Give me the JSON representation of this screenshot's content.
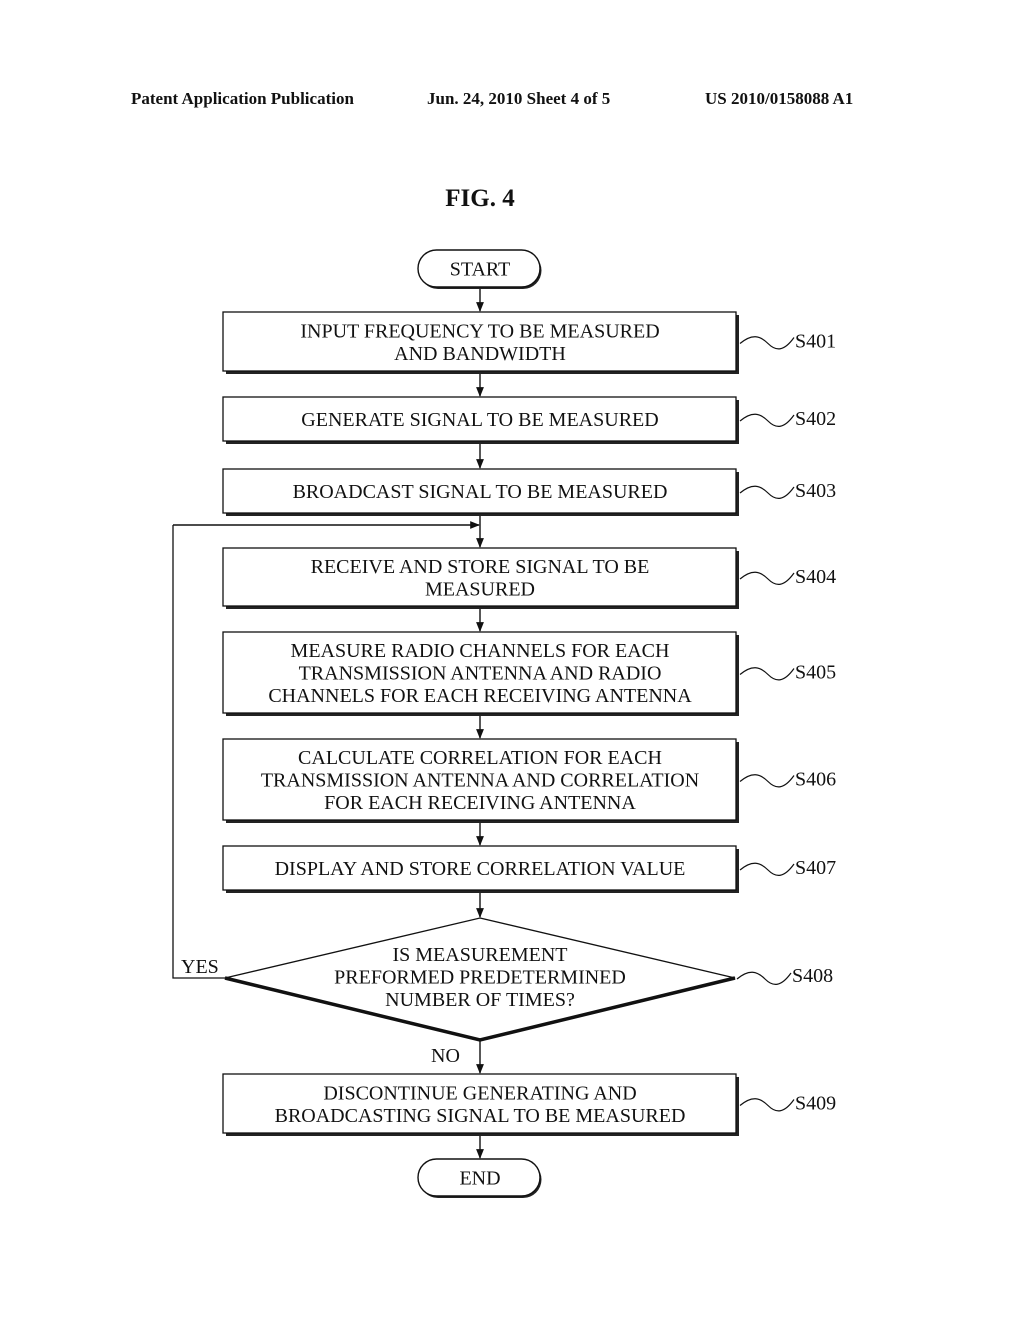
{
  "header": {
    "publication": "Patent Application Publication",
    "date_sheet": "Jun. 24, 2010  Sheet 4 of 5",
    "number": "US 2010/0158088 A1"
  },
  "figure": {
    "title": "FIG. 4"
  },
  "flowchart": {
    "start": "START",
    "end": "END",
    "steps": [
      {
        "id": "S401",
        "lines": [
          "INPUT FREQUENCY TO BE MEASURED",
          "AND BANDWIDTH"
        ]
      },
      {
        "id": "S402",
        "lines": [
          "GENERATE SIGNAL TO BE MEASURED"
        ]
      },
      {
        "id": "S403",
        "lines": [
          "BROADCAST SIGNAL TO BE MEASURED"
        ]
      },
      {
        "id": "S404",
        "lines": [
          "RECEIVE AND STORE SIGNAL TO BE",
          "MEASURED"
        ]
      },
      {
        "id": "S405",
        "lines": [
          "MEASURE RADIO CHANNELS FOR EACH",
          "TRANSMISSION ANTENNA AND RADIO",
          "CHANNELS FOR EACH RECEIVING ANTENNA"
        ]
      },
      {
        "id": "S406",
        "lines": [
          "CALCULATE CORRELATION FOR EACH",
          "TRANSMISSION ANTENNA AND CORRELATION",
          "FOR EACH RECEIVING ANTENNA"
        ]
      },
      {
        "id": "S407",
        "lines": [
          "DISPLAY AND STORE CORRELATION VALUE"
        ]
      },
      {
        "id": "S408",
        "lines": [
          "IS MEASUREMENT",
          "PREFORMED PREDETERMINED",
          "NUMBER OF TIMES?"
        ]
      },
      {
        "id": "S409",
        "lines": [
          "DISCONTINUE GENERATING AND",
          "BROADCASTING SIGNAL TO BE MEASURED"
        ]
      }
    ],
    "yes_label": "YES",
    "no_label": "NO"
  }
}
